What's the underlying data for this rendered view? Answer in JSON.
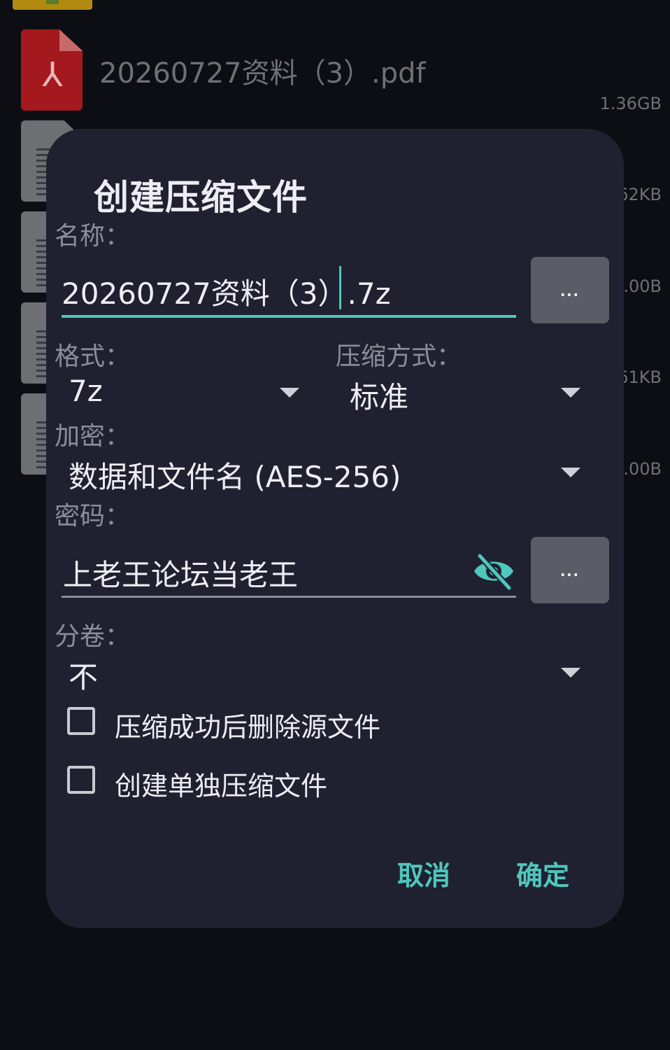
{
  "background": {
    "filename": "20260727资料（3）.pdf",
    "sizes": [
      "1.36GB",
      "62KB",
      ".00B",
      "61KB",
      ".00B"
    ],
    "icons": [
      "folder-icon",
      "pdf-icon",
      "document-icon"
    ]
  },
  "dialog": {
    "title": "创建压缩文件",
    "name_label": "名称：",
    "name_value": "20260727资料（3）.7z",
    "browse_label": "...",
    "format_label": "格式：",
    "format_value": "7z",
    "method_label": "压缩方式：",
    "method_value": "标准",
    "encrypt_label": "加密：",
    "encrypt_value": "数据和文件名 (AES-256)",
    "password_label": "密码：",
    "password_value": "上老王论坛当老王",
    "password_more_label": "...",
    "volume_label": "分卷：",
    "volume_value": "不",
    "delete_source_label": "压缩成功后删除源文件",
    "delete_source_checked": false,
    "separate_label": "创建单独压缩文件",
    "separate_checked": false,
    "cancel_label": "取消",
    "ok_label": "确定"
  },
  "colors": {
    "accent": "#4fc7bd",
    "dialog_bg": "#1f2130",
    "page_bg": "#0d0e13",
    "button_bg": "#5b5d66"
  }
}
